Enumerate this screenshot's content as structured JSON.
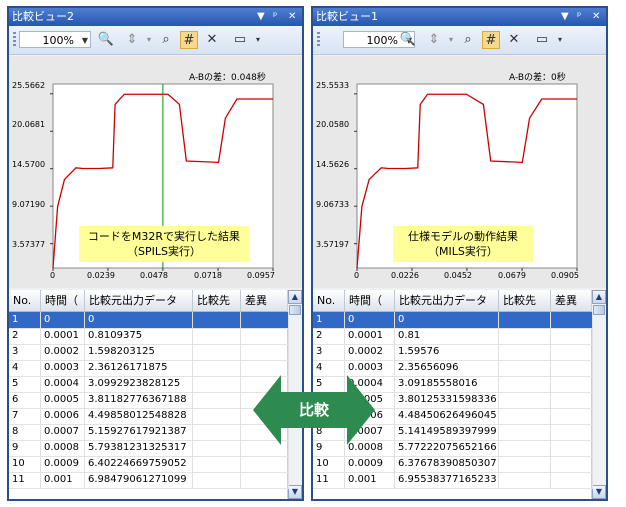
{
  "left": {
    "title": "比較ビュー2",
    "zoom": "100%",
    "diff_label": "A-Bの差：0.048秒",
    "yticks": [
      "25.5662",
      "20.0681",
      "14.5700",
      "9.07190",
      "3.57377"
    ],
    "xticks": [
      "0",
      "0.0239",
      "0.0478",
      "0.0718",
      "0.0957"
    ],
    "note_line1": "コードをM32Rで実行した結果",
    "note_line2": "（SPILS実行）",
    "columns": [
      "No.",
      "時間（",
      "比較元出力データ",
      "比較先",
      "差異"
    ],
    "rows": [
      [
        "1",
        "0",
        "0"
      ],
      [
        "2",
        "0.0001",
        "0.8109375"
      ],
      [
        "3",
        "0.0002",
        "1.598203125"
      ],
      [
        "4",
        "0.0003",
        "2.36126171875"
      ],
      [
        "5",
        "0.0004",
        "3.0992923828125"
      ],
      [
        "6",
        "0.0005",
        "3.81182776367188"
      ],
      [
        "7",
        "0.0006",
        "4.49858012548828"
      ],
      [
        "8",
        "0.0007",
        "5.15927617921387"
      ],
      [
        "9",
        "0.0008",
        "5.79381231325317"
      ],
      [
        "10",
        "0.0009",
        "6.40224669759052"
      ],
      [
        "11",
        "0.001",
        "6.98479061271099"
      ]
    ]
  },
  "right": {
    "title": "比較ビュー1",
    "zoom": "100%",
    "diff_label": "A-Bの差：0秒",
    "yticks": [
      "25.5533",
      "20.0580",
      "14.5626",
      "9.06733",
      "3.57197"
    ],
    "xticks": [
      "0",
      "0.0226",
      "0.0452",
      "0.0679",
      "0.0905"
    ],
    "note_line1": "仕様モデルの動作結果",
    "note_line2": "（MILS実行）",
    "columns": [
      "No.",
      "時間（",
      "比較元出力データ",
      "比較先",
      "差異"
    ],
    "rows": [
      [
        "1",
        "0",
        "0"
      ],
      [
        "2",
        "0.0001",
        "0.81"
      ],
      [
        "3",
        "0.0002",
        "1.59576"
      ],
      [
        "4",
        "0.0003",
        "2.35656096"
      ],
      [
        "5",
        "0.0004",
        "3.09185558016"
      ],
      [
        "6",
        "0.0005",
        "3.80125331598336"
      ],
      [
        "7",
        "0.0006",
        "4.48450626496045"
      ],
      [
        "8",
        "0.0007",
        "5.14149589397999"
      ],
      [
        "9",
        "0.0008",
        "5.77222075652166"
      ],
      [
        "10",
        "0.0009",
        "6.37678390850307"
      ],
      [
        "11",
        "0.001",
        "6.95538377165233"
      ]
    ]
  },
  "compare_label": "比較",
  "colors": {
    "accent": "#3169c6",
    "trace": "#cc0000",
    "cursor": "#009900",
    "arrow": "#2e8b4f",
    "note": "#ffff99"
  },
  "chart_data": [
    {
      "type": "line",
      "series": [
        {
          "x": [
            0,
            0.002,
            0.005,
            0.01,
            0.013,
            0.02,
            0.026,
            0.027,
            0.031,
            0.05,
            0.055,
            0.058,
            0.072,
            0.075,
            0.08,
            0.0957
          ],
          "y": [
            0,
            9,
            13,
            14.7,
            14.6,
            14.6,
            14.7,
            24,
            25.5,
            25.5,
            24,
            15.7,
            15.5,
            22,
            24.8,
            24.8
          ]
        }
      ],
      "xlim": [
        0,
        0.0957
      ],
      "ylim": [
        0,
        27
      ],
      "yticks": [
        25.5662,
        20.0681,
        14.57,
        9.0719,
        3.57377
      ],
      "xticks": [
        0,
        0.0239,
        0.0478,
        0.0718,
        0.0957
      ],
      "cursor_x": 0.0478
    },
    {
      "type": "line",
      "series": [
        {
          "x": [
            0,
            0.002,
            0.005,
            0.01,
            0.013,
            0.02,
            0.025,
            0.026,
            0.029,
            0.045,
            0.052,
            0.055,
            0.068,
            0.071,
            0.076,
            0.0905
          ],
          "y": [
            0,
            9,
            13,
            14.7,
            14.6,
            14.6,
            14.7,
            24,
            25.5,
            25.5,
            24,
            15.7,
            15.5,
            22,
            24.8,
            24.8
          ]
        }
      ],
      "xlim": [
        0,
        0.0905
      ],
      "ylim": [
        0,
        27
      ],
      "yticks": [
        25.5533,
        20.058,
        14.5626,
        9.06733,
        3.57197
      ],
      "xticks": [
        0,
        0.0226,
        0.0452,
        0.0679,
        0.0905
      ]
    }
  ]
}
